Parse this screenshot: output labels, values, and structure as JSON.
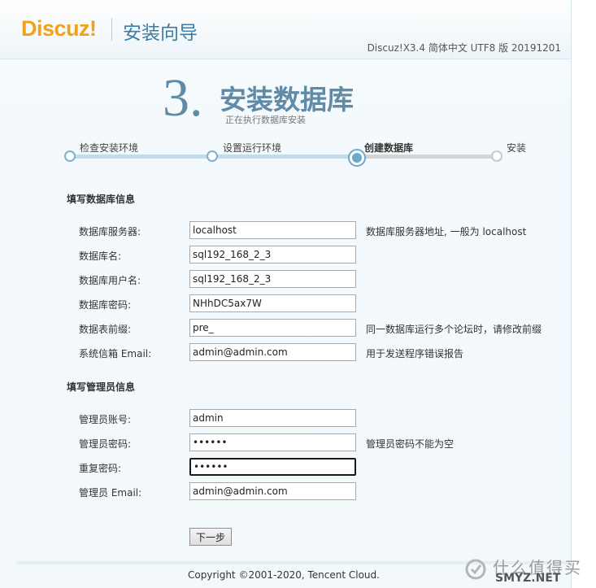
{
  "header": {
    "logo_text": "Discuz!",
    "wizard_title": "安装向导",
    "version": "Discuz!X3.4 简体中文 UTF8 版 20191201"
  },
  "step": {
    "number": "3.",
    "title": "安装数据库",
    "subtitle": "正在执行数据库安装"
  },
  "progress": {
    "steps": [
      {
        "label": "检查安装环境",
        "state": "done"
      },
      {
        "label": "设置运行环境",
        "state": "done"
      },
      {
        "label": "创建数据库",
        "state": "current"
      },
      {
        "label": "安装",
        "state": "todo"
      }
    ]
  },
  "db_section": {
    "title": "填写数据库信息",
    "fields": [
      {
        "label": "数据库服务器:",
        "value": "localhost",
        "hint": "数据库服务器地址, 一般为 localhost"
      },
      {
        "label": "数据库名:",
        "value": "sql192_168_2_3",
        "hint": ""
      },
      {
        "label": "数据库用户名:",
        "value": "sql192_168_2_3",
        "hint": ""
      },
      {
        "label": "数据库密码:",
        "value": "NHhDC5ax7W",
        "hint": ""
      },
      {
        "label": "数据表前缀:",
        "value": "pre_",
        "hint": "同一数据库运行多个论坛时，请修改前缀"
      },
      {
        "label": "系统信箱 Email:",
        "value": "admin@admin.com",
        "hint": "用于发送程序错误报告"
      }
    ]
  },
  "admin_section": {
    "title": "填写管理员信息",
    "fields": [
      {
        "label": "管理员账号:",
        "value": "admin",
        "hint": ""
      },
      {
        "label": "管理员密码:",
        "value": "••••••",
        "hint": "管理员密码不能为空"
      },
      {
        "label": "重复密码:",
        "value": "••••••",
        "hint": ""
      },
      {
        "label": "管理员 Email:",
        "value": "admin@admin.com",
        "hint": ""
      }
    ]
  },
  "next_button": "下一步",
  "footer": {
    "copyright": "Copyright ©2001-2020, Tencent Cloud."
  },
  "watermark": {
    "cn": "什么值得买",
    "en": "SMYZ.NET"
  },
  "colors": {
    "logo": "#f0a21b",
    "accent": "#5f8ba6",
    "progress_dot": "#6aa8cc"
  }
}
